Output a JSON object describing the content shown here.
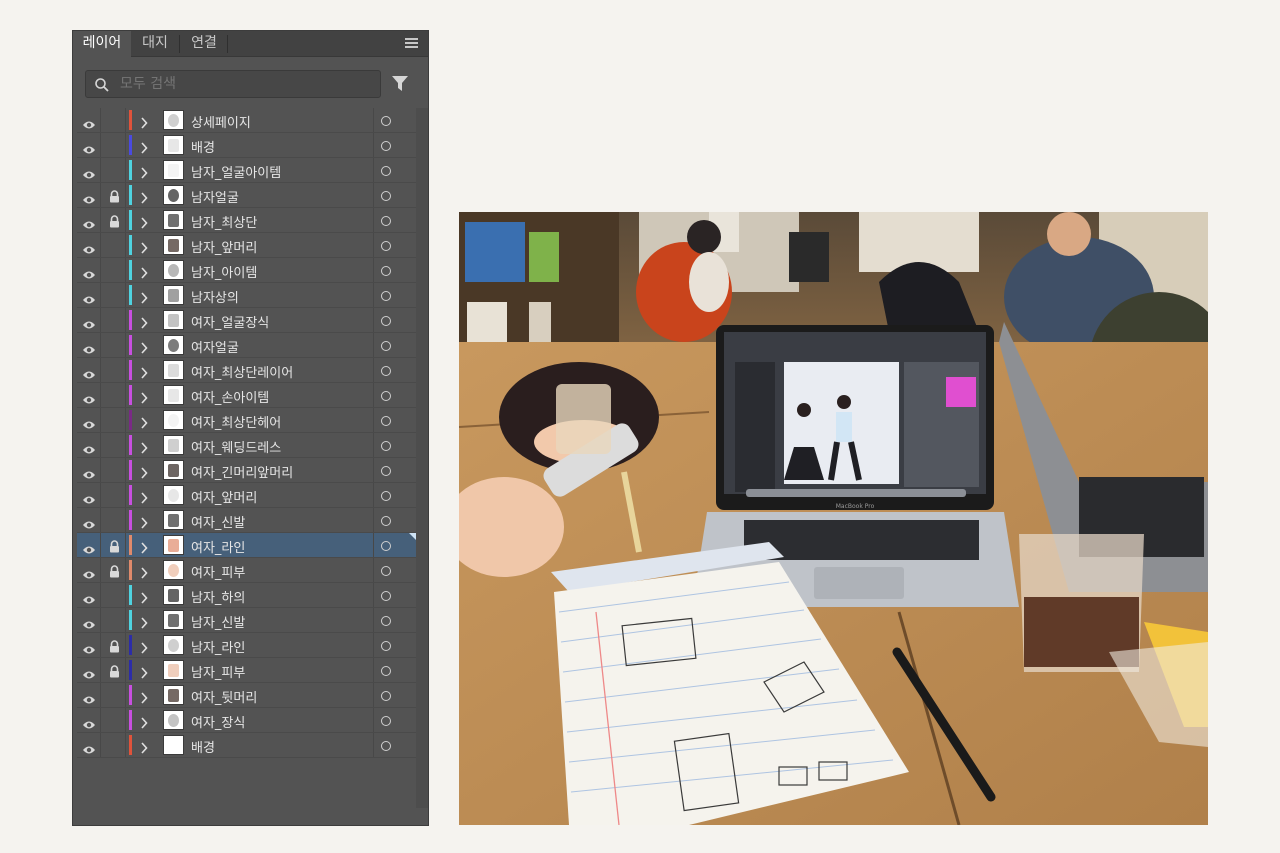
{
  "layers_panel": {
    "tabs": [
      {
        "label": "레이어",
        "active": true
      },
      {
        "label": "대지",
        "active": false
      },
      {
        "label": "연결",
        "active": false
      }
    ],
    "search_placeholder": "모두 검색",
    "layers": [
      {
        "name": "상세페이지",
        "locked": false,
        "color": "#e0533b",
        "selected": false
      },
      {
        "name": "배경",
        "locked": false,
        "color": "#4a4ae0",
        "selected": false
      },
      {
        "name": "남자_얼굴아이템",
        "locked": false,
        "color": "#4fd3e0",
        "selected": false
      },
      {
        "name": "남자얼굴",
        "locked": true,
        "color": "#4fd3e0",
        "selected": false
      },
      {
        "name": "남자_최상단",
        "locked": true,
        "color": "#4fd3e0",
        "selected": false
      },
      {
        "name": "남자_앞머리",
        "locked": false,
        "color": "#4fd3e0",
        "selected": false
      },
      {
        "name": "남자_아이템",
        "locked": false,
        "color": "#4fd3e0",
        "selected": false
      },
      {
        "name": "남자상의",
        "locked": false,
        "color": "#4fd3e0",
        "selected": false
      },
      {
        "name": "여자_얼굴장식",
        "locked": false,
        "color": "#c84fe0",
        "selected": false
      },
      {
        "name": "여자얼굴",
        "locked": false,
        "color": "#c84fe0",
        "selected": false
      },
      {
        "name": "여자_최상단레이어",
        "locked": false,
        "color": "#c84fe0",
        "selected": false
      },
      {
        "name": "여자_손아이템",
        "locked": false,
        "color": "#c84fe0",
        "selected": false
      },
      {
        "name": "여자_최상단헤어",
        "locked": false,
        "color": "#7a2a86",
        "selected": false
      },
      {
        "name": "여자_웨딩드레스",
        "locked": false,
        "color": "#c84fe0",
        "selected": false
      },
      {
        "name": "여자_긴머리앞머리",
        "locked": false,
        "color": "#c84fe0",
        "selected": false
      },
      {
        "name": "여자_앞머리",
        "locked": false,
        "color": "#c84fe0",
        "selected": false
      },
      {
        "name": "여자_신발",
        "locked": false,
        "color": "#c84fe0",
        "selected": false
      },
      {
        "name": "여자_라인",
        "locked": true,
        "color": "#e08a6b",
        "selected": true
      },
      {
        "name": "여자_피부",
        "locked": true,
        "color": "#e08a6b",
        "selected": false
      },
      {
        "name": "남자_하의",
        "locked": false,
        "color": "#4fd3e0",
        "selected": false
      },
      {
        "name": "남자_신발",
        "locked": false,
        "color": "#4fd3e0",
        "selected": false
      },
      {
        "name": "남자_라인",
        "locked": true,
        "color": "#2c2ca8",
        "selected": false
      },
      {
        "name": "남자_피부",
        "locked": true,
        "color": "#2c2ca8",
        "selected": false
      },
      {
        "name": "여자_뒷머리",
        "locked": false,
        "color": "#c84fe0",
        "selected": false
      },
      {
        "name": "여자_장식",
        "locked": false,
        "color": "#c84fe0",
        "selected": false
      },
      {
        "name": "배경",
        "locked": false,
        "color": "#e0533b",
        "selected": false
      }
    ]
  },
  "photo": {
    "laptop_screen_label": "MacBook Pro"
  }
}
